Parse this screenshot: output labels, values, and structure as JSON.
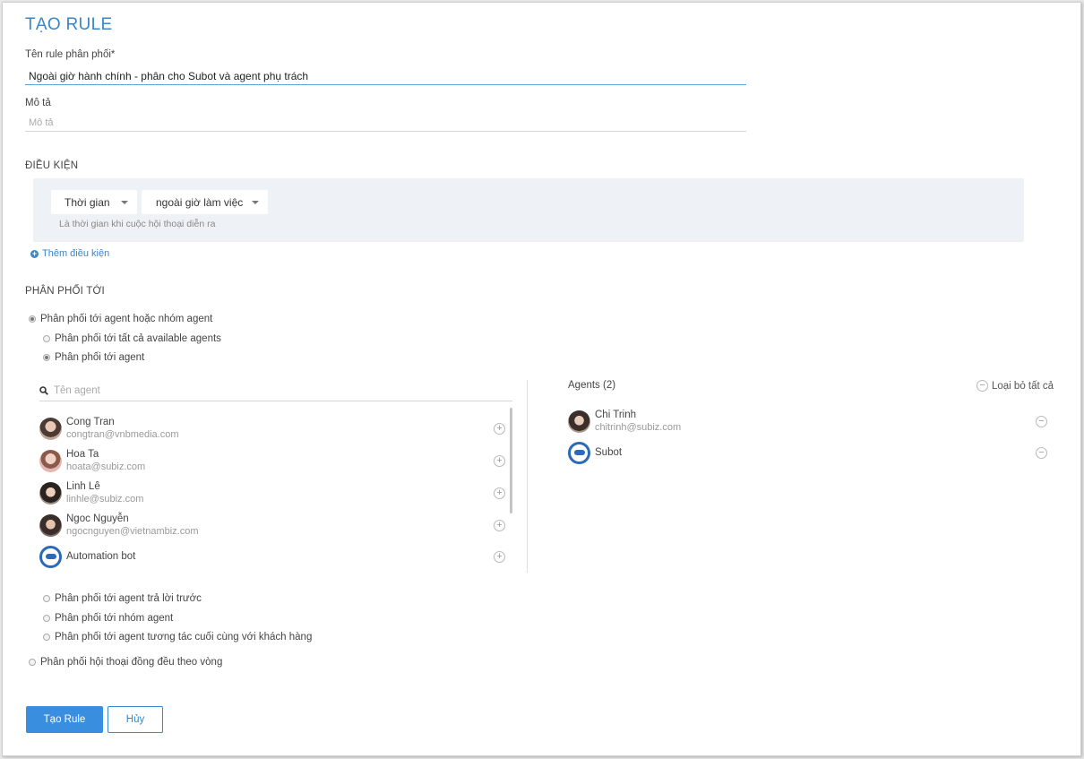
{
  "page": {
    "title": "TẠO RULE"
  },
  "form": {
    "name_label": "Tên rule phân phối*",
    "name_value": "Ngoài giờ hành chính - phân cho Subot và agent phụ trách",
    "desc_label": "Mô tả",
    "desc_placeholder": "Mô tả"
  },
  "conditions": {
    "heading": "ĐIỀU KIỆN",
    "field_select": "Thời gian",
    "value_select": "ngoài giờ làm việc",
    "hint": "Là thời gian khi cuộc hội thoại diễn ra",
    "add_link": "Thêm điều kiện"
  },
  "distribution": {
    "heading": "PHÂN PHỐI TỚI",
    "opt_agent_or_group": "Phân phối tới agent hoặc nhóm agent",
    "sub_all_available": "Phân phối tới tất cả available agents",
    "sub_agent": "Phân phối tới agent",
    "sub_first_reply": "Phân phối tới agent trả lời trước",
    "sub_group": "Phân phối tới nhóm agent",
    "sub_last_interaction": "Phân phối tới agent tương tác cuối cùng với khách hàng",
    "opt_round_robin": "Phân phối hội thoại đồng đều theo vòng",
    "selected_main": "agent_or_group",
    "selected_sub": "agent"
  },
  "agent_picker": {
    "search_placeholder": "Tên agent",
    "available": [
      {
        "name": "Cong Tran",
        "email": "congtran@vnbmedia.com",
        "avatar": "photo"
      },
      {
        "name": "Hoa Ta",
        "email": "hoata@subiz.com",
        "avatar": "photo"
      },
      {
        "name": "Linh Lê",
        "email": "linhle@subiz.com",
        "avatar": "photo"
      },
      {
        "name": "Ngoc Nguyễn",
        "email": "ngocnguyen@vietnambiz.com",
        "avatar": "photo"
      },
      {
        "name": "Automation bot",
        "email": "",
        "avatar": "bot"
      }
    ],
    "selected_title": "Agents (2)",
    "remove_all": "Loại bỏ tất cả",
    "selected": [
      {
        "name": "Chi Trinh",
        "email": "chitrinh@subiz.com",
        "avatar": "photo"
      },
      {
        "name": "Subot",
        "email": "",
        "avatar": "bot"
      }
    ]
  },
  "actions": {
    "create": "Tạo Rule",
    "cancel": "Hủy"
  },
  "colors": {
    "accent": "#3a86c8",
    "primary_button": "#3a8ee0",
    "condition_bg": "#eef1f6"
  }
}
